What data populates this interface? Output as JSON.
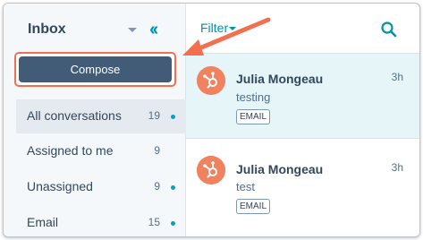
{
  "sidebar": {
    "title": "Inbox",
    "compose_label": "Compose",
    "items": [
      {
        "label": "All conversations",
        "count": "19",
        "unread": true,
        "active": true
      },
      {
        "label": "Assigned to me",
        "count": "9",
        "unread": false,
        "active": false
      },
      {
        "label": "Unassigned",
        "count": "9",
        "unread": true,
        "active": false
      },
      {
        "label": "Email",
        "count": "15",
        "unread": true,
        "active": false
      }
    ]
  },
  "main": {
    "filter_label": "Filter",
    "conversations": [
      {
        "name": "Julia Mongeau",
        "preview": "testing",
        "time": "3h",
        "channel": "EMAIL",
        "selected": true
      },
      {
        "name": "Julia Mongeau",
        "preview": "test",
        "time": "3h",
        "channel": "EMAIL",
        "selected": false
      }
    ]
  },
  "colors": {
    "accent": "#0091ae",
    "compose_bg": "#425b76",
    "annotation": "#f2704f",
    "avatar": "#f0825f",
    "unread_dot": "#00a4bd"
  }
}
